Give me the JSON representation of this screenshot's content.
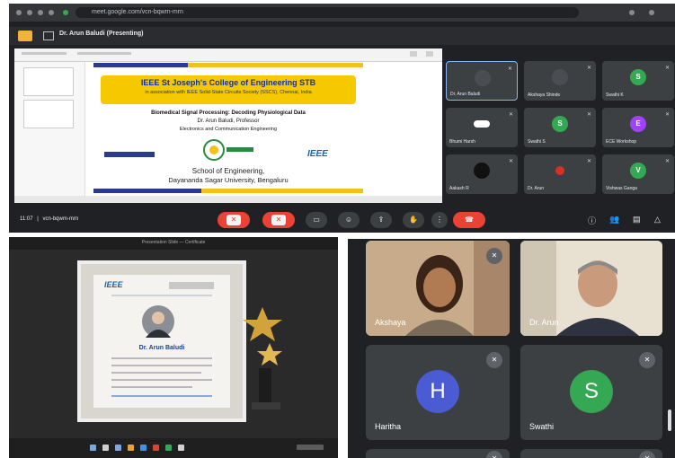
{
  "browser": {
    "url": "meet.google.com/vcn-bqwm-mrn"
  },
  "meet_top": {
    "presenting_title": "Dr. Arun Baludi (Presenting)",
    "meeting_time": "11:07",
    "meeting_code": "vcn-bqwm-mrn",
    "participants": [
      {
        "name": "Dr. Arun Baludi",
        "initial": "",
        "color": "#4a4d52"
      },
      {
        "name": "Akshaya Shinde",
        "initial": "",
        "color": "#4a4d52"
      },
      {
        "name": "Swathi K",
        "initial": "S",
        "color": "#34a853"
      },
      {
        "name": "Bhumi Harsh",
        "initial": "",
        "color": "#ffffff"
      },
      {
        "name": "Swathi S",
        "initial": "S",
        "color": "#34a853"
      },
      {
        "name": "ECE Workshop",
        "initial": "E",
        "color": "#a142f4"
      },
      {
        "name": "Aakash R",
        "initial": "",
        "color": "#111111"
      },
      {
        "name": "Dr. Arun",
        "initial": "",
        "color": "#d93025"
      },
      {
        "name": "Vishwas Ganga",
        "initial": "V",
        "color": "#34a853"
      }
    ]
  },
  "slide": {
    "college": "IEEE St Joseph's College of Engineering STB",
    "association": "in association with IEEE Solid-State Circuits Society (SSCS), Chennai, India",
    "talk": "Biomedical Signal Processing: Decoding Physiological Data",
    "speaker": "Dr. Arun Baludi, Professor",
    "department": "Electronics and Communication Engineering",
    "ieee_logo": "IEEE",
    "school": "School of Engineering,",
    "university": "Dayananda Sagar University, Bengaluru"
  },
  "certificate": {
    "window_title": "Presentation Slide — Certificate",
    "ieee_logo": "IEEE",
    "name": "Dr. Arun Baludi"
  },
  "meet_bottom": {
    "tiles": [
      {
        "name": "Akshaya",
        "initial": "",
        "color": ""
      },
      {
        "name": "Dr. Arun",
        "initial": "",
        "color": ""
      },
      {
        "name": "Haritha",
        "initial": "H",
        "color": "#4a5bd4"
      },
      {
        "name": "Swathi",
        "initial": "S",
        "color": "#34a853"
      }
    ]
  }
}
